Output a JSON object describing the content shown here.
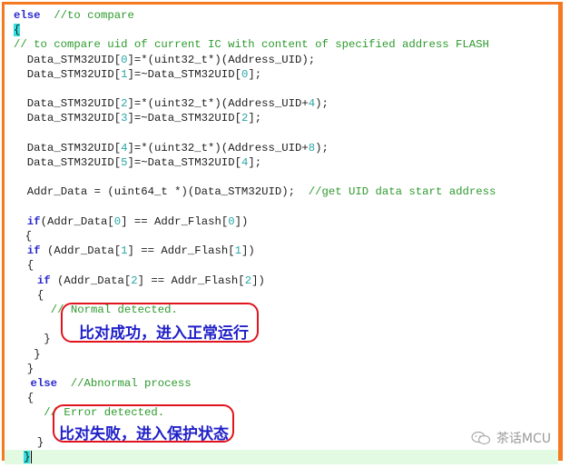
{
  "editor": {
    "lines": [
      {
        "indent": 1,
        "parts": [
          {
            "t": "else",
            "c": "kw"
          },
          {
            "t": "  //to compare",
            "c": "cm"
          }
        ]
      },
      {
        "indent": 1,
        "parts": [
          {
            "t": "{",
            "c": "brace-hl"
          }
        ]
      },
      {
        "indent": 1,
        "parts": [
          {
            "t": "// to compare uid of current IC with content of specified address FLASH",
            "c": "cm"
          }
        ]
      },
      {
        "indent": 3,
        "parts": [
          {
            "t": "Data_STM32UID[",
            "c": ""
          },
          {
            "t": "0",
            "c": "num"
          },
          {
            "t": "]=*(uint32_t*)(Address_UID);",
            "c": ""
          }
        ]
      },
      {
        "indent": 3,
        "parts": [
          {
            "t": "Data_STM32UID[",
            "c": ""
          },
          {
            "t": "1",
            "c": "num"
          },
          {
            "t": "]=~Data_STM32UID[",
            "c": ""
          },
          {
            "t": "0",
            "c": "num"
          },
          {
            "t": "];",
            "c": ""
          }
        ]
      },
      {
        "indent": 0,
        "parts": []
      },
      {
        "indent": 3,
        "parts": [
          {
            "t": "Data_STM32UID[",
            "c": ""
          },
          {
            "t": "2",
            "c": "num"
          },
          {
            "t": "]=*(uint32_t*)(Address_UID+",
            "c": ""
          },
          {
            "t": "4",
            "c": "num"
          },
          {
            "t": ");",
            "c": ""
          }
        ]
      },
      {
        "indent": 3,
        "parts": [
          {
            "t": "Data_STM32UID[",
            "c": ""
          },
          {
            "t": "3",
            "c": "num"
          },
          {
            "t": "]=~Data_STM32UID[",
            "c": ""
          },
          {
            "t": "2",
            "c": "num"
          },
          {
            "t": "];",
            "c": ""
          }
        ]
      },
      {
        "indent": 0,
        "parts": []
      },
      {
        "indent": 3,
        "parts": [
          {
            "t": "Data_STM32UID[",
            "c": ""
          },
          {
            "t": "4",
            "c": "num"
          },
          {
            "t": "]=*(uint32_t*)(Address_UID+",
            "c": ""
          },
          {
            "t": "8",
            "c": "num"
          },
          {
            "t": ");",
            "c": ""
          }
        ]
      },
      {
        "indent": 3,
        "parts": [
          {
            "t": "Data_STM32UID[",
            "c": ""
          },
          {
            "t": "5",
            "c": "num"
          },
          {
            "t": "]=~Data_STM32UID[",
            "c": ""
          },
          {
            "t": "4",
            "c": "num"
          },
          {
            "t": "];",
            "c": ""
          }
        ]
      },
      {
        "indent": 0,
        "parts": []
      },
      {
        "indent": 3,
        "parts": [
          {
            "t": "Addr_Data = (uint64_t *)(Data_STM32UID);  ",
            "c": ""
          },
          {
            "t": "//get UID data start address",
            "c": "cm"
          }
        ]
      },
      {
        "indent": 0,
        "parts": []
      },
      {
        "indent": 3,
        "parts": [
          {
            "t": "if",
            "c": "kw"
          },
          {
            "t": "(Addr_Data[",
            "c": ""
          },
          {
            "t": "0",
            "c": "num"
          },
          {
            "t": "] == Addr_Flash[",
            "c": ""
          },
          {
            "t": "0",
            "c": "num"
          },
          {
            "t": "])",
            "c": ""
          }
        ]
      },
      {
        "indent": 2.7,
        "parts": [
          {
            "t": "{",
            "c": ""
          }
        ]
      },
      {
        "indent": 3,
        "parts": [
          {
            "t": "if",
            "c": "kw"
          },
          {
            "t": " (Addr_Data[",
            "c": ""
          },
          {
            "t": "1",
            "c": "num"
          },
          {
            "t": "] == Addr_Flash[",
            "c": ""
          },
          {
            "t": "1",
            "c": "num"
          },
          {
            "t": "])",
            "c": ""
          }
        ]
      },
      {
        "indent": 3,
        "parts": [
          {
            "t": "{",
            "c": ""
          }
        ]
      },
      {
        "indent": 4.5,
        "parts": [
          {
            "t": "if",
            "c": "kw"
          },
          {
            "t": " (Addr_Data[",
            "c": ""
          },
          {
            "t": "2",
            "c": "num"
          },
          {
            "t": "] == Addr_Flash[",
            "c": ""
          },
          {
            "t": "2",
            "c": "num"
          },
          {
            "t": "])",
            "c": ""
          }
        ]
      },
      {
        "indent": 4.5,
        "parts": [
          {
            "t": "{",
            "c": ""
          }
        ]
      },
      {
        "indent": 6.5,
        "parts": [
          {
            "t": "// Normal detected.",
            "c": "cm"
          }
        ]
      },
      {
        "indent": 0,
        "parts": []
      },
      {
        "indent": 5.5,
        "parts": [
          {
            "t": "}",
            "c": ""
          }
        ]
      },
      {
        "indent": 4,
        "parts": [
          {
            "t": "}",
            "c": ""
          }
        ]
      },
      {
        "indent": 3,
        "parts": [
          {
            "t": "}",
            "c": ""
          }
        ]
      },
      {
        "indent": 3.5,
        "parts": [
          {
            "t": "else",
            "c": "kw"
          },
          {
            "t": "  //Abnormal process",
            "c": "cm"
          }
        ]
      },
      {
        "indent": 3,
        "parts": [
          {
            "t": "{",
            "c": ""
          }
        ]
      },
      {
        "indent": 5.5,
        "parts": [
          {
            "t": "// Error detected.",
            "c": "cm"
          }
        ]
      },
      {
        "indent": 0,
        "parts": []
      },
      {
        "indent": 4.5,
        "parts": [
          {
            "t": "}",
            "c": ""
          }
        ]
      },
      {
        "indent": 2.5,
        "parts": [
          {
            "t": "}",
            "c": "brace-hl"
          }
        ],
        "cursor": true
      }
    ]
  },
  "annotations": {
    "normal": "比对成功，进入正常运行",
    "error": "比对失败，进入保护状态"
  },
  "watermark": {
    "icon": "wechat-icon",
    "text": "茶话MCU"
  },
  "colors": {
    "frame_border": "#f47920",
    "annotation_border": "#e0141e",
    "annotation_text": "#2020c8",
    "keyword": "#2a2ad0",
    "comment": "#2d9a2d",
    "number": "#2aa6a6",
    "cursor_line": "#e2fae2"
  }
}
